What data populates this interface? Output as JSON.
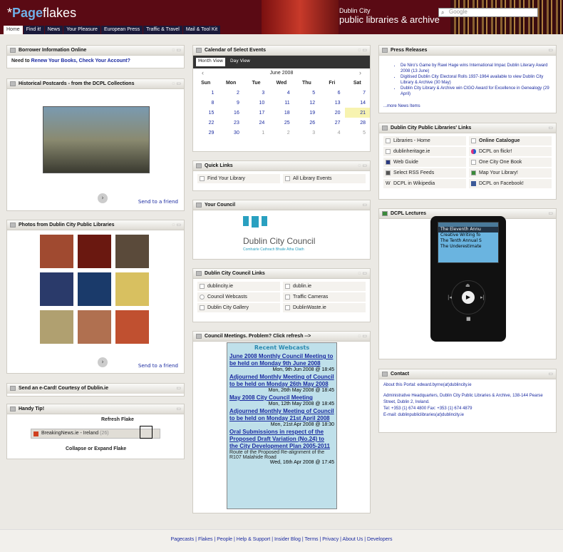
{
  "header": {
    "logo_mark": "Page",
    "logo_rest": "flakes",
    "lib_city": "Dublin City",
    "lib_name": "public libraries & archive",
    "search_placeholder": "Google"
  },
  "nav": [
    "Home",
    "Find it!",
    "News",
    "Your Pleasure",
    "European Press",
    "Traffic & Travel",
    "Mail & Tool Kit"
  ],
  "borrower": {
    "title": "Borrower Information Online",
    "prefix": "Need to ",
    "link": "Renew Your Books, Check Your Account?"
  },
  "postcards": {
    "title": "Historical Postcards - from the DCPL Collections",
    "send": "Send to a friend"
  },
  "photos": {
    "title": "Photos from Dublin City Public Libraries",
    "send": "Send to a friend"
  },
  "ecard": {
    "title": "Send an e-Card! Courtesy of Dublin.ie"
  },
  "tip": {
    "title": "Handy Tip!",
    "refresh": "Refresh Flake",
    "feed": "BreakingNews.ie - Ireland",
    "count": "(26)",
    "collapse": "Collapse or Expand Flake"
  },
  "calendar": {
    "title": "Calendar of Select Events",
    "month_view": "Month View",
    "day_view": "Day View",
    "month": "June 2008",
    "days": [
      "Sun",
      "Mon",
      "Tue",
      "Wed",
      "Thu",
      "Fri",
      "Sat"
    ],
    "weeks": [
      [
        "1",
        "2",
        "3",
        "4",
        "5",
        "6",
        "7"
      ],
      [
        "8",
        "9",
        "10",
        "11",
        "12",
        "13",
        "14"
      ],
      [
        "15",
        "16",
        "17",
        "18",
        "19",
        "20",
        "21"
      ],
      [
        "22",
        "23",
        "24",
        "25",
        "26",
        "27",
        "28"
      ],
      [
        "29",
        "30",
        "1",
        "2",
        "3",
        "4",
        "5"
      ]
    ]
  },
  "quicklinks": {
    "title": "Quick Links",
    "items": [
      "Find Your Library",
      "All Library Events"
    ]
  },
  "council": {
    "title": "Your Council",
    "name": "Dublin City Council",
    "irish": "Comhairle Cathrach Bhaile Átha Cliath"
  },
  "councillinks": {
    "title": "Dublin City Council Links",
    "items": [
      "dublincity.ie",
      "dublin.ie",
      "Council Webcasts",
      "Traffic Cameras",
      "Dublin City Gallery",
      "DublinWaste.ie"
    ]
  },
  "meetings": {
    "title": "Council Meetings. Problem? Click refresh -->",
    "header": "Recent Webcasts",
    "items": [
      {
        "title": "June 2008 Monthly Council Meeting to be held on Monday 9th June 2008",
        "date": "Mon, 9th Jun 2008 @ 18:45",
        "desc": ""
      },
      {
        "title": "Adjourned Monthly Meeting of Council to be held on Monday 26th May 2008",
        "date": "Mon, 26th May 2008 @ 18:45",
        "desc": ""
      },
      {
        "title": "May 2008 City Council Meeting",
        "date": "Mon, 12th May 2008 @ 18:45",
        "desc": ""
      },
      {
        "title": "Adjourned Monthly Meeting of Council to be held on Monday 21st April 2008",
        "date": "Mon, 21st Apr 2008 @ 18:30",
        "desc": ""
      },
      {
        "title": "Oral Submissions in respect of the Proposed Draft Variation (No.24) to the City Development Plan 2005-2011",
        "date": "Wed, 16th Apr 2008 @ 17:45",
        "desc": "Route of the Proposed Re-alignment of the R107 Malahide Road"
      }
    ]
  },
  "press": {
    "title": "Press Releases",
    "items": [
      "De Niro's Game by Rawi Hage wins International Impac Dublin Literary Award 2008 (13 June)",
      "Digitised Dublin City Electoral Rolls 1937-1964 available to view Dublin City Library & Archive (30 May)",
      "Dublin City Library & Archive win CIGO Award for Excellence in Genealogy (29 April)"
    ],
    "more": "...more News Items"
  },
  "dcpllinks": {
    "title": "Dublin City Public Libraries' Links",
    "items": [
      "Libraries - Home",
      "Online Catalogue",
      "dublinheritage.ie",
      "DCPL on flickr!",
      "Web Guide",
      "One City One Book",
      "Select RSS Feeds",
      "Map Your Library!",
      "DCPL in Wikipedia",
      "DCPL on Facebook!"
    ]
  },
  "lectures": {
    "title": "DCPL Lectures",
    "rows": [
      "The Eleventh Annu",
      "Creative Writing fo",
      "The Tenth Annual S",
      "The Underestimate"
    ]
  },
  "contact": {
    "title": "Contact",
    "about": "About this Portal: edward.byrne(at)dublincity.ie",
    "address": "Administrative Headquarters, Dublin City Public Libraries & Archive, 138-144 Pearse Street, Dublin 2, Ireland.",
    "tel": "Tel: +353 (1) 674 4800 Fax: +353 (1) 674 4879",
    "email": "E-mail: dublinpubliclibraries(at)dublincity.ie"
  },
  "footer": "Pagecasts | Flakes | People | Help & Support | Insider Blog | Terms | Privacy | About Us | Developers"
}
